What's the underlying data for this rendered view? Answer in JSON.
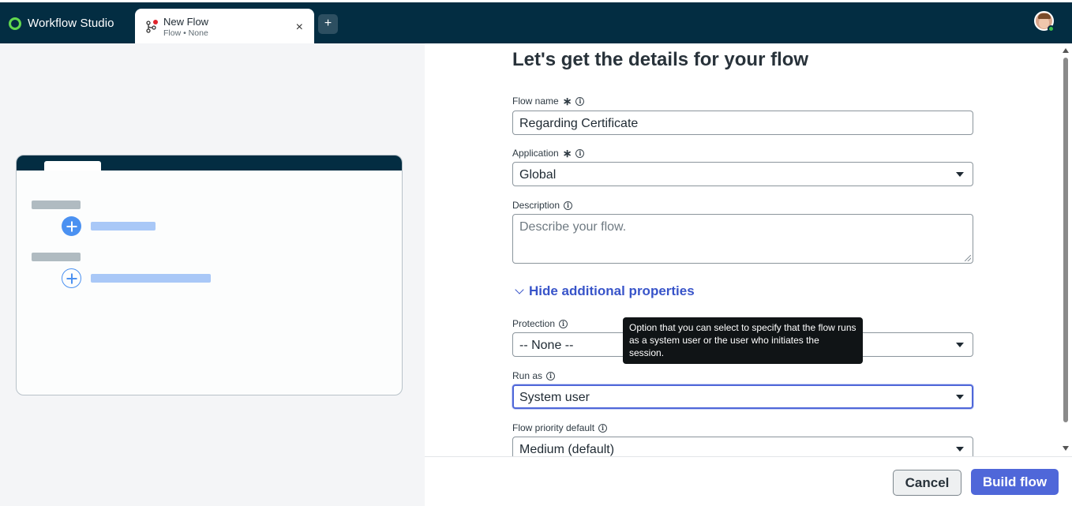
{
  "app": {
    "title": "Workflow Studio"
  },
  "tab": {
    "title": "New Flow",
    "subtitle": "Flow • None",
    "close_glyph": "×",
    "icon": "flow-branch-icon"
  },
  "add_tab_glyph": "+",
  "user": {
    "avatar": "user-avatar",
    "status_color": "#3dbf4a"
  },
  "form": {
    "heading": "Let's get the details for your flow",
    "flow_name": {
      "label": "Flow name",
      "required_mark": "∗",
      "value": "Regarding Certificate"
    },
    "application": {
      "label": "Application",
      "required_mark": "∗",
      "value": "Global"
    },
    "description": {
      "label": "Description",
      "placeholder": "Describe your flow."
    },
    "toggle_link": "Hide additional properties",
    "protection": {
      "label": "Protection",
      "value": "-- None --"
    },
    "run_as": {
      "label": "Run as",
      "value": "System user"
    },
    "priority": {
      "label": "Flow priority default",
      "value": "Medium (default)"
    },
    "tooltip": "Option that you can select to specify that the flow runs as a system user or the user who initiates the session."
  },
  "footer": {
    "cancel_label": "Cancel",
    "build_label": "Build flow"
  },
  "colors": {
    "topbar": "#032d42",
    "accent": "#4f67d9",
    "link": "#3854c9",
    "brand_green": "#62d84e"
  }
}
